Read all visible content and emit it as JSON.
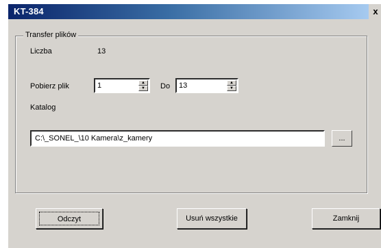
{
  "window": {
    "title": "KT-384",
    "close_label": "x"
  },
  "transfer": {
    "group_label": "Transfer plików",
    "count_label": "Liczba",
    "count_value": "13",
    "download_label": "Pobierz plik",
    "from_value": "1",
    "to_label": "Do",
    "to_value": "13",
    "catalog_label": "Katalog",
    "catalog_path": "C:\\_SONEL_\\10 Kamera\\z_kamery",
    "browse_label": "..."
  },
  "buttons": {
    "read_label": "Odczyt",
    "delete_all_label": "Usuń wszystkie",
    "close_label": "Zamknij"
  }
}
